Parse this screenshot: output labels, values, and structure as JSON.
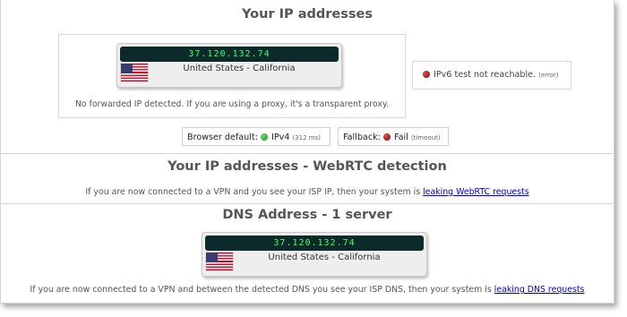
{
  "ip_section": {
    "title": "Your IP addresses",
    "ip": "37.120.132.74",
    "location": "United States - California",
    "flag": "us-flag",
    "forwarded_note": "No forwarded IP detected. If you are using a proxy, it's a transparent proxy.",
    "ipv6": {
      "status_icon": "red-dot-icon",
      "text": "IPv6 test not reachable.",
      "detail": "(error)"
    },
    "browser_default": {
      "label": "Browser default:",
      "status_icon": "green-dot-icon",
      "value": "IPv4",
      "detail": "(312 ms)"
    },
    "fallback": {
      "label": "Fallback:",
      "status_icon": "red-dot-icon",
      "value": "Fail",
      "detail": "(timeout)"
    }
  },
  "webrtc_section": {
    "title": "Your IP addresses - WebRTC detection",
    "text": "If you are now connected to a VPN and you see your ISP IP, then your system is ",
    "link": "leaking WebRTC requests"
  },
  "dns_section": {
    "title": "DNS Address - 1 server",
    "ip": "37.120.132.74",
    "location": "United States - California",
    "flag": "us-flag",
    "text": "If you are now connected to a VPN and between the detected DNS you see your ISP DNS, then your system is ",
    "link": "leaking DNS requests"
  },
  "colors": {
    "lcd_bg": "#0c2a2a",
    "lcd_text": "#3cff6a",
    "ok": "#1a8f1a",
    "error": "#8a0000",
    "link": "#0000cc"
  }
}
